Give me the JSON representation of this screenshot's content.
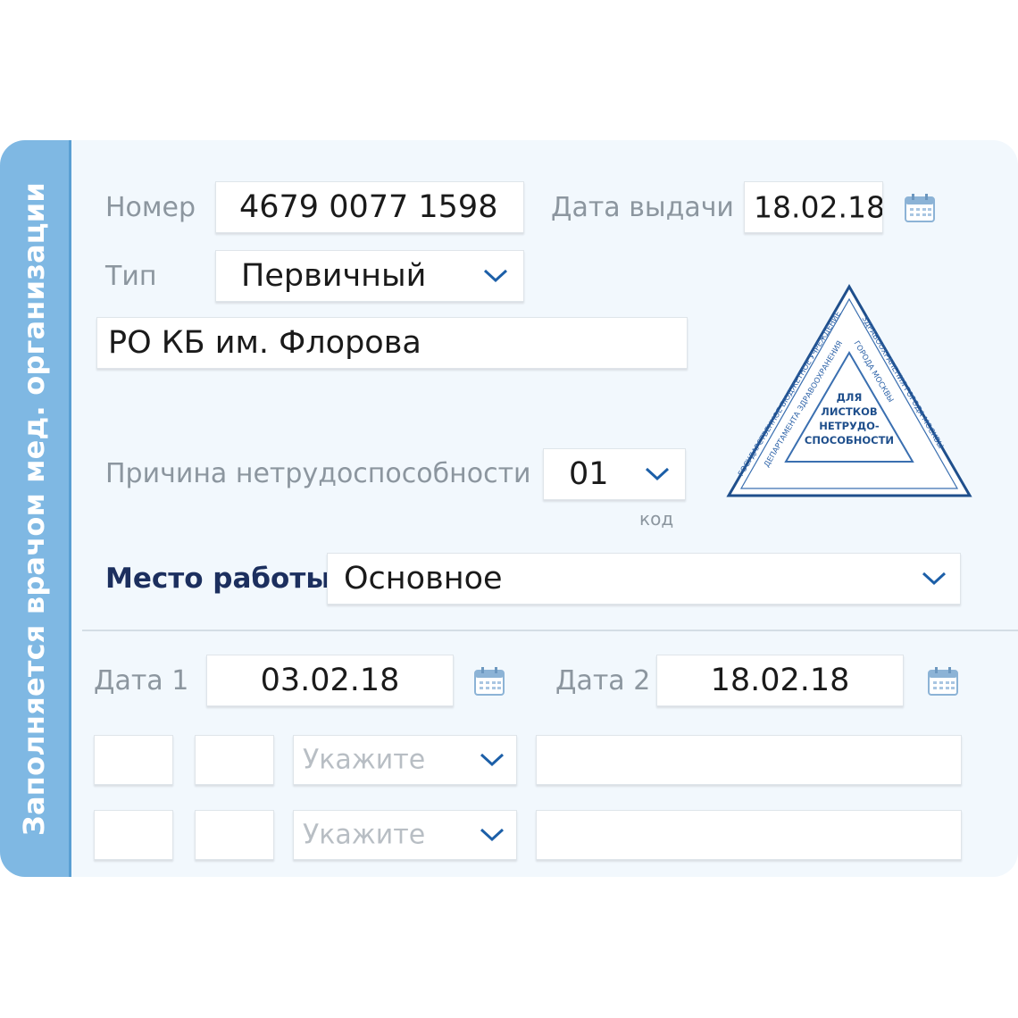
{
  "sidebar": {
    "label": "Заполняется врачом мед. организации"
  },
  "form": {
    "number": {
      "label": "Номер",
      "value": "4679 0077 1598"
    },
    "issue_date": {
      "label": "Дата выдачи",
      "value": "18.02.18"
    },
    "type": {
      "label": "Тип",
      "value": "Первичный"
    },
    "organization": {
      "value": "РО КБ им. Флорова"
    },
    "disability_reason": {
      "label": "Причина нетрудоспособности",
      "value": "01",
      "code_label": "код"
    },
    "workplace": {
      "label": "Место работы",
      "value": "Основное"
    },
    "date1": {
      "label": "Дата 1",
      "value": "03.02.18"
    },
    "date2": {
      "label": "Дата 2",
      "value": "18.02.18"
    },
    "rows": [
      {
        "select_placeholder": "Укажите"
      },
      {
        "select_placeholder": "Укажите"
      }
    ]
  },
  "stamp": {
    "inner_lines": [
      "ДЛЯ",
      "ЛИСТКОВ",
      "НЕТРУДО-",
      "СПОСОБНОСТИ"
    ]
  },
  "icons": [
    "calendar-icon",
    "chevron-down-icon"
  ],
  "colors": {
    "sidebar": "#7fb8e3",
    "accent": "#1c5fa8",
    "label": "#8c969f",
    "heading": "#1c2f5e"
  }
}
